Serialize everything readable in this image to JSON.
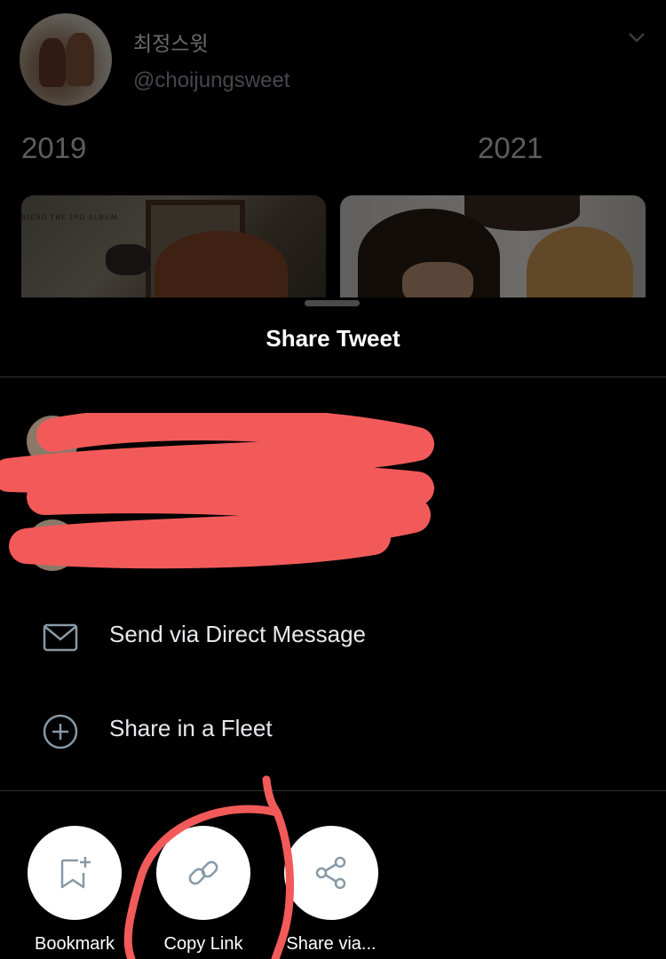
{
  "tweet": {
    "display_name": "최정스윗",
    "handle": "@choijungsweet",
    "years": [
      "2019",
      "2021"
    ],
    "image1_text": "RIEND THE 2ND ALBUM"
  },
  "sheet": {
    "title": "Share Tweet",
    "options": [
      {
        "label": "Send via Direct Message",
        "icon": "envelope-icon"
      },
      {
        "label": "Share in a Fleet",
        "icon": "plus-circle-icon"
      }
    ],
    "actions": [
      {
        "label": "Bookmark",
        "icon": "bookmark-add-icon"
      },
      {
        "label": "Copy Link",
        "icon": "link-icon"
      },
      {
        "label": "Share via...",
        "icon": "share-icon"
      }
    ]
  },
  "colors": {
    "background": "#000000",
    "divider": "#2f3336",
    "redaction": "#f25a5a",
    "action_circle": "#ffffff",
    "icon_gray": "#8899a6"
  }
}
